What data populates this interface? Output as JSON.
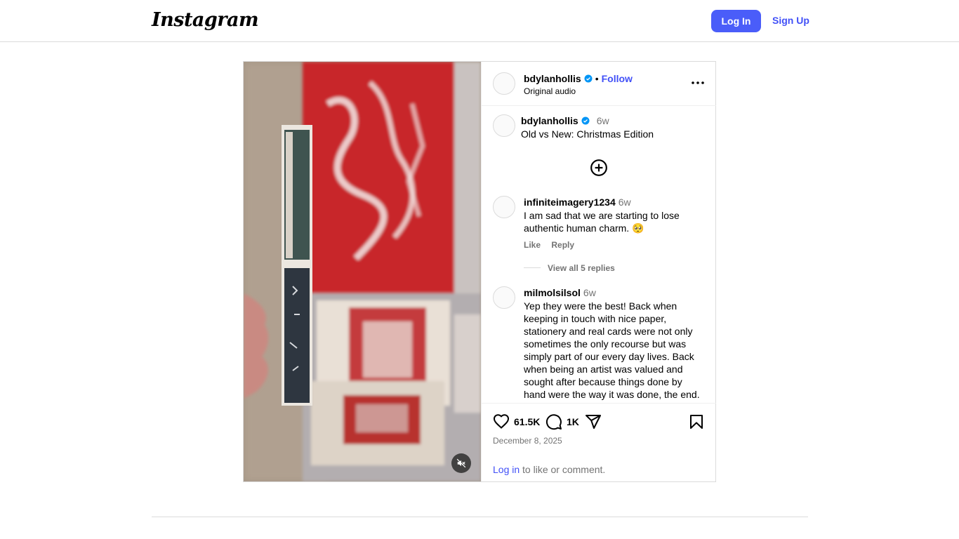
{
  "header": {
    "logo": "Instagram",
    "login_label": "Log In",
    "signup_label": "Sign Up"
  },
  "post": {
    "author": {
      "username": "bdylanhollis",
      "verified": true,
      "follow_label": "Follow",
      "audio": "Original audio"
    },
    "caption": {
      "username": "bdylanhollis",
      "time": "6w",
      "text": "Old vs New: Christmas Edition"
    },
    "comments": [
      {
        "username": "infiniteimagery1234",
        "time": "6w",
        "text": "I am sad that we are starting to lose authentic human charm. 🥺",
        "like_label": "Like",
        "reply_label": "Reply",
        "view_replies": "View all 5 replies"
      },
      {
        "username": "milmolsilsol",
        "time": "6w",
        "text": "Yep they were the best! Back when keeping in touch with nice paper, stationery and real cards were not only sometimes the only recourse but was simply part of our every day lives. Back when being an artist was valued and sought after because things done by hand were the way it was done, the end."
      }
    ],
    "likes": "61.5K",
    "comment_count": "1K",
    "date": "December 8, 2025",
    "login_prompt": {
      "link": "Log in",
      "rest": " to like or comment."
    },
    "icons": [
      "heart-icon",
      "comment-icon",
      "share-icon",
      "bookmark-icon",
      "more-icon",
      "add-comment-icon",
      "mute-icon",
      "verified-icon"
    ]
  },
  "colors": {
    "accent": "#4a5df9",
    "link": "#4150f7",
    "verified": "#0095f6",
    "muted_text": "#737373",
    "border": "#dbdbdb"
  }
}
